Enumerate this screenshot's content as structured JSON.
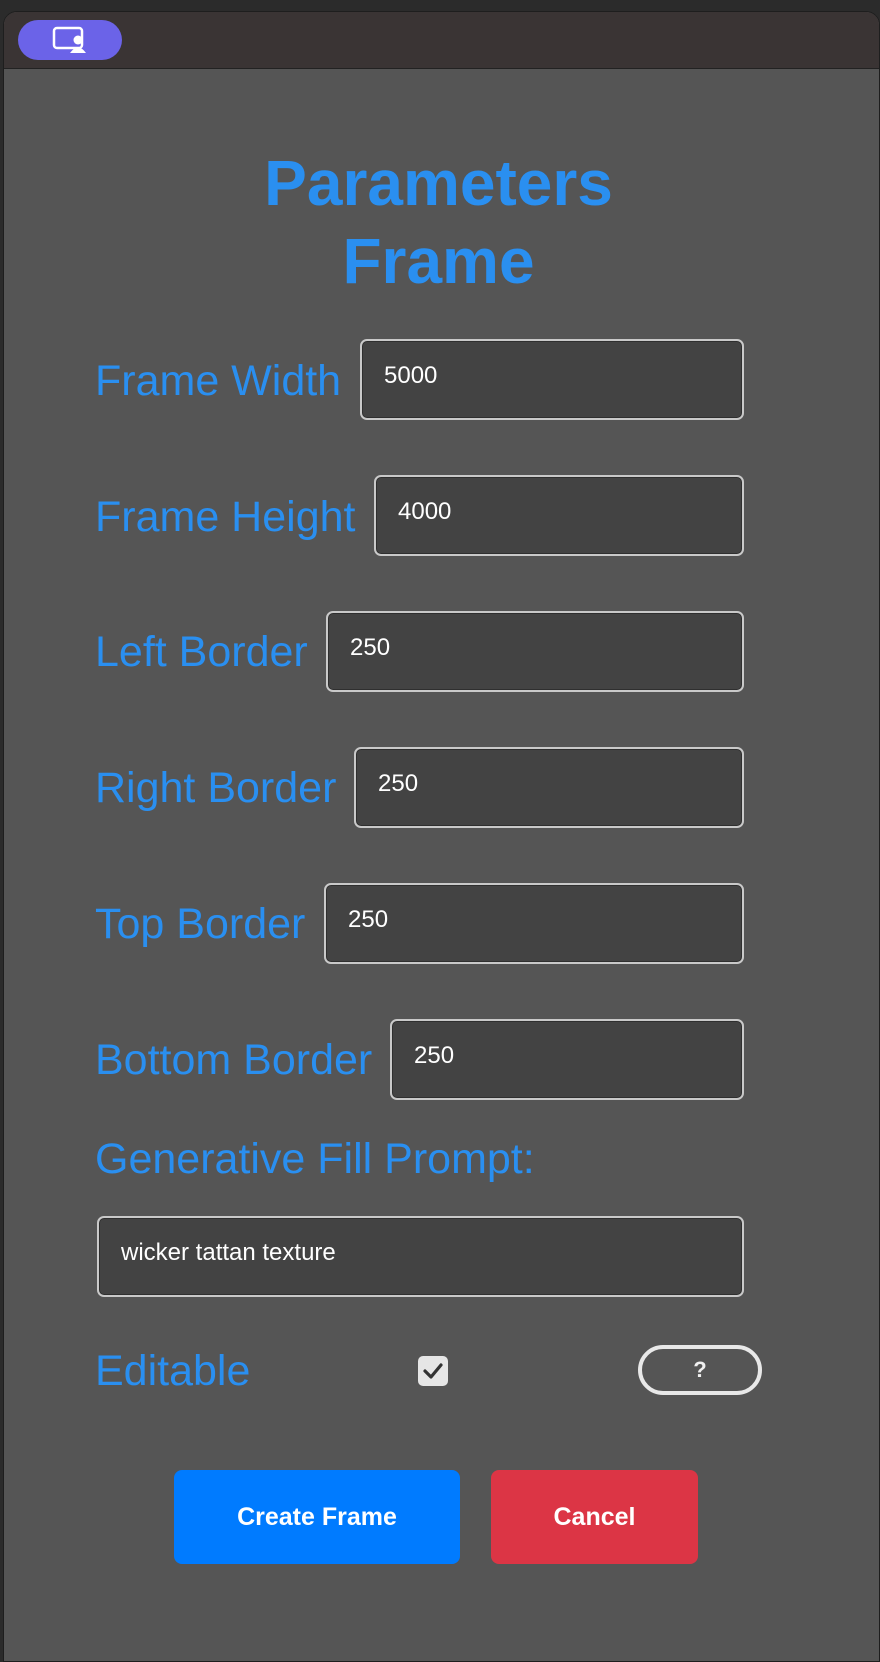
{
  "app": {
    "icon": "user-screen-icon",
    "accent": "#6b63e8"
  },
  "title": {
    "line1": "Parameters",
    "line2": "Frame",
    "color": "#2a8ff0"
  },
  "fields": {
    "frame_width": {
      "label": "Frame Width",
      "value": "5000"
    },
    "frame_height": {
      "label": "Frame Height",
      "value": "4000"
    },
    "left_border": {
      "label": "Left Border",
      "value": "250"
    },
    "right_border": {
      "label": "Right Border",
      "value": "250"
    },
    "top_border": {
      "label": "Top Border",
      "value": "250"
    },
    "bottom_border": {
      "label": "Bottom Border",
      "value": "250"
    }
  },
  "prompt": {
    "label": "Generative Fill Prompt:",
    "value": "wicker tattan texture"
  },
  "editable": {
    "label": "Editable",
    "checked": true
  },
  "help": {
    "label": "?"
  },
  "buttons": {
    "create": {
      "label": "Create Frame",
      "color": "#007bff"
    },
    "cancel": {
      "label": "Cancel",
      "color": "#dc3545"
    }
  }
}
